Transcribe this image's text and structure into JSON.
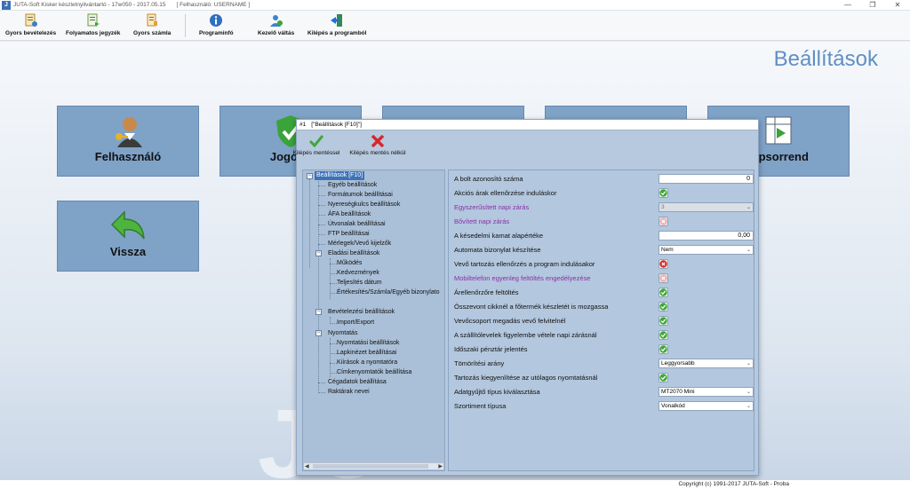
{
  "window": {
    "title": "JUTA-Soft Kisker készletnyilvántartó - 17w050 - 2017.05.15",
    "user_info": "[ Felhasználó:   USERNAME ]",
    "minimize": "—",
    "restore": "❐",
    "close": "✕",
    "app_icon": "J"
  },
  "toolbar": {
    "items": [
      {
        "label": "Gyors bevételezés",
        "icon": "receipt-icon"
      },
      {
        "label": "Folyamatos jegyzék",
        "icon": "list-icon"
      },
      {
        "label": "Gyors számla",
        "icon": "invoice-icon"
      },
      {
        "label": "Programinfó",
        "icon": "info-icon"
      },
      {
        "label": "Kezelő váltás",
        "icon": "user-switch-icon"
      },
      {
        "label": "Kilépés a programból",
        "icon": "exit-icon"
      }
    ]
  },
  "main": {
    "page_title": "Beállítások",
    "watermark": "JU",
    "tiles": [
      {
        "label": "Felhasználó",
        "icon": "user-keys-icon"
      },
      {
        "label": "Jogosu",
        "icon": "shield-check-icon"
      },
      {
        "label": "",
        "icon": "gear-icon"
      },
      {
        "label": "",
        "icon": "globe-icon"
      },
      {
        "label": "lopsorrend",
        "icon": "table-arrow-icon"
      },
      {
        "label": "Vissza",
        "icon": "back-arrow-icon"
      }
    ]
  },
  "dialog": {
    "caption_num": "#1",
    "caption_text": "[\"Beállítások [F10]\"]",
    "save_exit": "Kilépés mentéssel",
    "nosave_exit": "Kilépés mentés nélkül",
    "tree": [
      "Beállítások [F10]",
      "Egyéb beállítások",
      "Formátumok beállításai",
      "Nyereségkulcs beállítások",
      "ÁFA beállítások",
      "Útvonalak beállításai",
      "FTP beállításai",
      "Mérlegek/Vevő kijelzők",
      "Eladási beállítások",
      "Működés",
      "Kedvezmények",
      "Teljesítés dátum",
      "Értékesítés/Számla/Egyéb bizonylato",
      "Bevételezési beállítások",
      "Import/Export",
      "Nyomtatás",
      "Nyomtatási beállítások",
      "Lapkinézet beállításai",
      "Kiírások a nyomtatóra",
      "Címkenyomtatók beállítása",
      "Cégadatok beállítása",
      "Raktárak nevei"
    ],
    "settings": [
      {
        "label": "A bolt azonosító száma",
        "type": "number",
        "value": "0"
      },
      {
        "label": "Akciós árak ellenőrzése induláskor",
        "type": "check",
        "value": "on"
      },
      {
        "label": "Egyszerűsített napi zárás",
        "type": "combo-disabled",
        "value": "3",
        "purple": true
      },
      {
        "label": "Bővített napi zárás",
        "type": "check-disabled",
        "value": "off",
        "purple": true
      },
      {
        "label": "A késedelmi kamat alapértéke",
        "type": "number",
        "value": "0,00"
      },
      {
        "label": "Automata bizonylat készítése",
        "type": "combo",
        "value": "Nem"
      },
      {
        "label": "Vevő tartozás ellenőrzés a program indulásakor",
        "type": "check",
        "value": "off"
      },
      {
        "label": "Mobiltelefon egyenleg feltöltés engedélyezése",
        "type": "check-disabled",
        "value": "off",
        "purple": true
      },
      {
        "label": "Árellenőrzőre feltöltés",
        "type": "check",
        "value": "on"
      },
      {
        "label": "Összevont cikknél a főtermék készletét is mozgassa",
        "type": "check",
        "value": "on"
      },
      {
        "label": "Vevőcsoport megadás vevő felvitelnél",
        "type": "check",
        "value": "on"
      },
      {
        "label": "A szállítólevelek figyelembe vétele napi zárásnál",
        "type": "check",
        "value": "on"
      },
      {
        "label": "Időszaki pénztár jelentés",
        "type": "check",
        "value": "on"
      },
      {
        "label": "Tömörítési arány",
        "type": "combo",
        "value": "Leggyorsabb"
      },
      {
        "label": "Tartozás kiegyenlítése az utólagos nyomtatásnál",
        "type": "check",
        "value": "on"
      },
      {
        "label": "Adatgyűjtő típus kiválasztása",
        "type": "combo",
        "value": "MT2070 Mini"
      },
      {
        "label": "Szortiment típusa",
        "type": "combo",
        "value": "Vonalkód"
      }
    ]
  },
  "status": {
    "text": "Copyright (c) 1991-2017 JUTA-Soft  -  Proba"
  },
  "colors": {
    "tile": "#7fa2c7",
    "title": "#5f8fc4",
    "purple_label": "#8a2fa8",
    "check_green": "#3fa83a",
    "cross_red": "#d8282a",
    "tree_selected": "#3d72b8"
  }
}
